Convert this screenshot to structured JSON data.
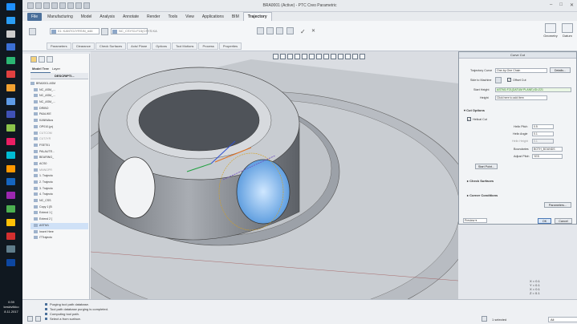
{
  "taskbar": {
    "time": "0:39",
    "day": "keskiviikko",
    "date": "8.11.2017",
    "icon_colors": [
      "#1e90ff",
      "#2a9df4",
      "#cccccc",
      "#3b6fd4",
      "#2bb673",
      "#e04040",
      "#f0a030",
      "#5e9be6",
      "#3f51b5",
      "#8bc34a",
      "#e91e63",
      "#00bcd4",
      "#ff9800",
      "#1565c0",
      "#9c27b0",
      "#4caf50",
      "#ffc107",
      "#d32f2f",
      "#607d8b",
      "#0d47a1"
    ]
  },
  "window": {
    "title": "BRA0001 (Active) - PTC Creo Parametric",
    "controls": [
      "–",
      "□",
      "✕"
    ]
  },
  "ribbon_tabs": [
    "File",
    "Manufacturing",
    "Model",
    "Analysis",
    "Annotate",
    "Render",
    "Tools",
    "View",
    "Applications",
    "BIM",
    "Trajectory"
  ],
  "active_tab": "Trajectory",
  "ribbon": {
    "tool_field": "01: KANTOJYRSIN_#46",
    "coord_field": "NC_CSYS1:F15(CSYS:KA",
    "geometry_label": "Geometry",
    "datum_label": "Datum"
  },
  "subtabs": [
    "Parameters",
    "Clearance",
    "Check Surfaces",
    "Axis/ Plane",
    "Options",
    "Tool Motions",
    "Process",
    "Properties"
  ],
  "panel": {
    "tabs": [
      "Model Tree",
      "Layer"
    ],
    "column_header": "DESCRIPTI...",
    "tree_items": [
      {
        "label": "BRA0001.ASM",
        "grey": false,
        "selected": false
      },
      {
        "label": "NC_ASM_...",
        "grey": false,
        "selected": false
      },
      {
        "label": "NC_ASM_...",
        "grey": false,
        "selected": false
      },
      {
        "label": "NC_ASM_...",
        "grey": false,
        "selected": false
      },
      {
        "label": "DRIBO",
        "grey": false,
        "selected": false
      },
      {
        "label": "PAALIKE",
        "grey": false,
        "selected": false
      },
      {
        "label": "KANNAtus",
        "grey": false,
        "selected": false
      },
      {
        "label": "OP010.jyrj",
        "grey": false,
        "selected": false
      },
      {
        "label": "CUTCOM",
        "grey": true,
        "selected": false
      },
      {
        "label": "CUTJYR",
        "grey": true,
        "selected": false
      },
      {
        "label": "FSET01",
        "grey": false,
        "selected": false
      },
      {
        "label": "PALAUTE...",
        "grey": false,
        "selected": false
      },
      {
        "label": "BEARING_",
        "grey": false,
        "selected": false
      },
      {
        "label": "ACS0",
        "grey": false,
        "selected": false
      },
      {
        "label": "MNNGPR",
        "grey": true,
        "selected": false
      },
      {
        "label": "1. Trajecto",
        "grey": false,
        "selected": false
      },
      {
        "label": "2. Trajecto",
        "grey": false,
        "selected": false
      },
      {
        "label": "3. Trajecto",
        "grey": false,
        "selected": false
      },
      {
        "label": "4. Trajecto",
        "grey": false,
        "selected": false
      },
      {
        "label": "NC_CSS",
        "grey": false,
        "selected": false
      },
      {
        "label": "Copy 1 [B",
        "grey": false,
        "selected": false
      },
      {
        "label": "Extend 1 [",
        "grey": false,
        "selected": false
      },
      {
        "label": "Extend 2 [",
        "grey": false,
        "selected": false
      },
      {
        "label": "ASTM1",
        "grey": false,
        "selected": true
      },
      {
        "label": "Insert Here",
        "grey": false,
        "selected": false
      },
      {
        "label": "ITTrajecto",
        "grey": false,
        "selected": false
      }
    ]
  },
  "dialog": {
    "title": "Curve Cut",
    "trajectory_curve_label": "Trajectory Curve",
    "trajectory_curve_value": "One-by-One Chain",
    "details_button": "Details...",
    "side_label": "Side to Machine",
    "offset_cut_label": "Offset Cut",
    "start_height_label": "Start Height",
    "start_height_value": "ASTM1:F21(DATUM PLANE):ID=221",
    "height_label": "Height",
    "height_value": "Click here to add item",
    "cut_options_label": "Cut Options",
    "helical_cut_label": "Helical Cut",
    "helix_pitch_label": "Helix Pitch",
    "helix_pitch_value": "0.5",
    "helix_angle_label": "Helix Angle",
    "helix_angle_value": "0.1",
    "helix_height_label": "Helix Height",
    "helix_height_value": "0.1",
    "boundaries_label": "Boundaries",
    "boundaries_value": "BOTH_BOUNDS",
    "adjust_pitch_label": "Adjust Pitch",
    "adjust_pitch_value": "YES",
    "start_point_button": "Start Point...",
    "check_surfaces_label": "Check Surfaces",
    "corner_conditions_label": "Corner Conditions",
    "parameters_button": "Parameters...",
    "preview_label": "Preview",
    "ok_button": "OK",
    "cancel_button": "Cancel"
  },
  "coords": {
    "line1": "X = 0.1",
    "line2": "Y = 0.1",
    "line3": "X = 0.1",
    "line4": "Z = 0.1"
  },
  "status": {
    "messages": [
      "Purging tool path database.",
      "Tool path database purging is completed.",
      "Computing tool path.",
      "Select a from surface."
    ],
    "selected_count": "1 selected",
    "filter_value": "All"
  }
}
